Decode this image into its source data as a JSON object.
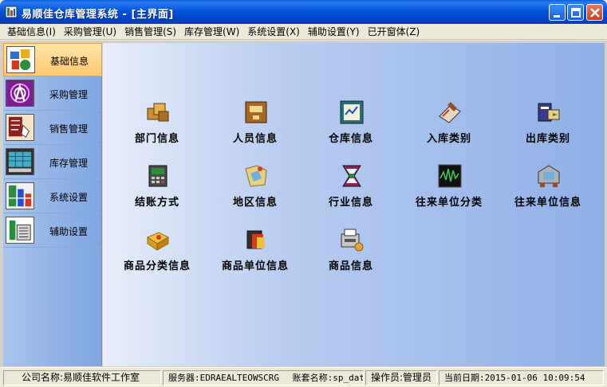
{
  "window": {
    "title": "易顺佳仓库管理系统 - [主界面]",
    "icon": "app-icon"
  },
  "menubar": {
    "items": [
      {
        "label": "基础信息(I)"
      },
      {
        "label": "采购管理(U)"
      },
      {
        "label": "销售管理(S)"
      },
      {
        "label": "库存管理(W)"
      },
      {
        "label": "系统设置(X)"
      },
      {
        "label": "辅助设置(Y)"
      },
      {
        "label": "已开窗体(Z)"
      }
    ]
  },
  "sidebar": {
    "items": [
      {
        "label": "基础信息",
        "icon": "basic-info-icon",
        "active": true
      },
      {
        "label": "采购管理",
        "icon": "purchase-icon"
      },
      {
        "label": "销售管理",
        "icon": "sales-icon"
      },
      {
        "label": "库存管理",
        "icon": "inventory-icon"
      },
      {
        "label": "系统设置",
        "icon": "system-settings-icon"
      },
      {
        "label": "辅助设置",
        "icon": "aux-settings-icon"
      }
    ]
  },
  "tiles": [
    {
      "label": "部门信息",
      "icon": "department-icon"
    },
    {
      "label": "人员信息",
      "icon": "staff-icon"
    },
    {
      "label": "仓库信息",
      "icon": "warehouse-icon"
    },
    {
      "label": "入库类别",
      "icon": "inbound-type-icon"
    },
    {
      "label": "出库类别",
      "icon": "outbound-type-icon"
    },
    {
      "label": "结账方式",
      "icon": "settlement-icon"
    },
    {
      "label": "地区信息",
      "icon": "region-icon"
    },
    {
      "label": "行业信息",
      "icon": "industry-icon"
    },
    {
      "label": "往来单位分类",
      "icon": "partner-category-icon"
    },
    {
      "label": "往来单位信息",
      "icon": "partner-info-icon"
    },
    {
      "label": "商品分类信息",
      "icon": "product-category-icon"
    },
    {
      "label": "商品单位信息",
      "icon": "product-unit-icon"
    },
    {
      "label": "商品信息",
      "icon": "product-info-icon"
    }
  ],
  "statusbar": {
    "company": "公司名称:易顺佳软件工作室",
    "server": "服务器:EDRAEALTEOWSCRG",
    "account": "账套名称:sp_data",
    "operator": "操作员:管理员",
    "date": "当前日期:2015-01-06 10:09:54"
  },
  "colors": {
    "titlebar": "#0355dc",
    "sidebar_active": "#ffc870",
    "content_gradient_end": "#8eb0e6"
  }
}
